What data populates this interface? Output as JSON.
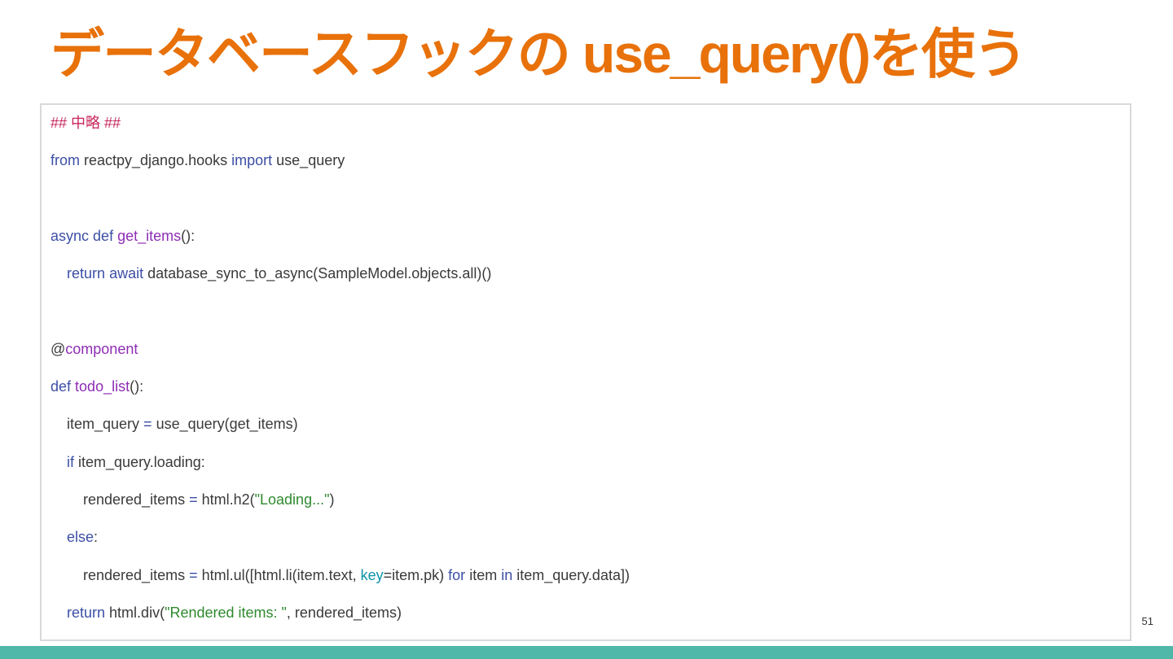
{
  "slide": {
    "title": "データベースフックの use_query()を使う",
    "page_number": "51"
  },
  "colors": {
    "title": "#e8710a",
    "default": "#3a3a3a",
    "keyword": "#3c4fa5",
    "funcname": "#8e2db5",
    "string": "#2f8a2f",
    "comment": "#c8275b",
    "kwarg": "#0b94a6",
    "border": "#d9d9d9",
    "footer": "#4fb8a8"
  },
  "code": [
    [
      {
        "t": "## 中略 ##",
        "c": "comment"
      }
    ],
    [
      {
        "t": "from",
        "c": "keyword"
      },
      {
        "t": " reactpy_django.hooks ",
        "c": "default"
      },
      {
        "t": "import",
        "c": "keyword"
      },
      {
        "t": " use_query",
        "c": "default"
      }
    ],
    [],
    [
      {
        "t": "async",
        "c": "keyword"
      },
      {
        "t": " ",
        "c": "default"
      },
      {
        "t": "def",
        "c": "keyword"
      },
      {
        "t": " ",
        "c": "default"
      },
      {
        "t": "get_items",
        "c": "funcname"
      },
      {
        "t": "():",
        "c": "default"
      }
    ],
    [
      {
        "t": "    ",
        "c": "default"
      },
      {
        "t": "return",
        "c": "keyword"
      },
      {
        "t": " ",
        "c": "default"
      },
      {
        "t": "await",
        "c": "keyword"
      },
      {
        "t": " database_sync_to_async(SampleModel.objects.all)()",
        "c": "default"
      }
    ],
    [],
    [
      {
        "t": "@",
        "c": "default"
      },
      {
        "t": "component",
        "c": "funcname"
      }
    ],
    [
      {
        "t": "def",
        "c": "keyword"
      },
      {
        "t": " ",
        "c": "default"
      },
      {
        "t": "todo_list",
        "c": "funcname"
      },
      {
        "t": "():",
        "c": "default"
      }
    ],
    [
      {
        "t": "    item_query ",
        "c": "default"
      },
      {
        "t": "=",
        "c": "keyword"
      },
      {
        "t": " use_query(get_items)",
        "c": "default"
      }
    ],
    [
      {
        "t": "    ",
        "c": "default"
      },
      {
        "t": "if",
        "c": "keyword"
      },
      {
        "t": " item_query.loading:",
        "c": "default"
      }
    ],
    [
      {
        "t": "        rendered_items ",
        "c": "default"
      },
      {
        "t": "=",
        "c": "keyword"
      },
      {
        "t": " html.h2(",
        "c": "default"
      },
      {
        "t": "\"Loading...\"",
        "c": "string"
      },
      {
        "t": ")",
        "c": "default"
      }
    ],
    [
      {
        "t": "    ",
        "c": "default"
      },
      {
        "t": "else",
        "c": "keyword"
      },
      {
        "t": ":",
        "c": "default"
      }
    ],
    [
      {
        "t": "        rendered_items ",
        "c": "default"
      },
      {
        "t": "=",
        "c": "keyword"
      },
      {
        "t": " html.ul([html.li(item.text, ",
        "c": "default"
      },
      {
        "t": "key",
        "c": "kwarg"
      },
      {
        "t": "=item.pk) ",
        "c": "default"
      },
      {
        "t": "for",
        "c": "keyword"
      },
      {
        "t": " item ",
        "c": "default"
      },
      {
        "t": "in",
        "c": "keyword"
      },
      {
        "t": " item_query.data])",
        "c": "default"
      }
    ],
    [
      {
        "t": "    ",
        "c": "default"
      },
      {
        "t": "return",
        "c": "keyword"
      },
      {
        "t": " html.div(",
        "c": "default"
      },
      {
        "t": "\"Rendered items: \"",
        "c": "string"
      },
      {
        "t": ", rendered_items)",
        "c": "default"
      }
    ]
  ]
}
